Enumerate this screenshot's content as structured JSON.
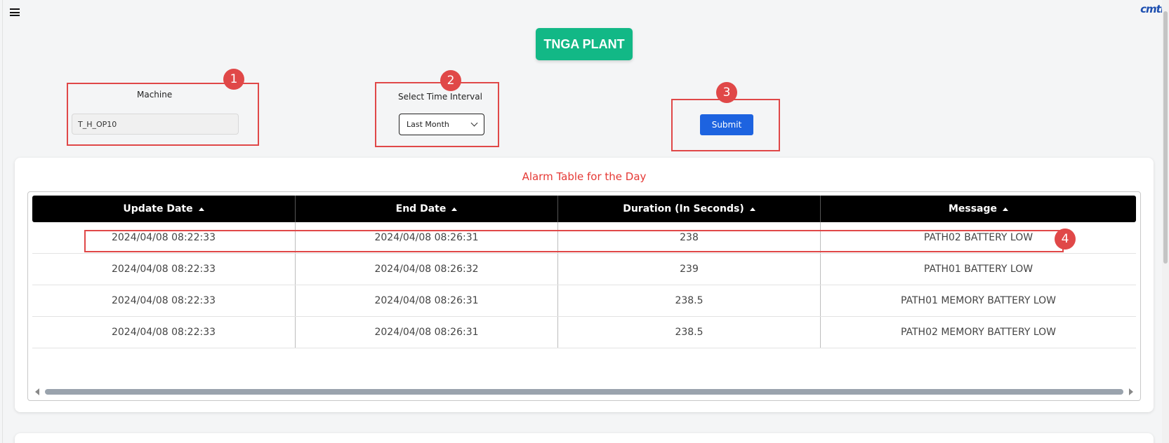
{
  "header": {
    "plant_name": "TNGA PLANT",
    "logo_text": "cmti"
  },
  "filters": {
    "machine_label": "Machine",
    "machine_value": "T_H_OP10",
    "interval_label": "Select Time Interval",
    "interval_selected": "Last Month",
    "submit_label": "Submit"
  },
  "annotations": [
    "1",
    "2",
    "3",
    "4"
  ],
  "alarm_table": {
    "title": "Alarm Table for the Day",
    "columns": [
      "Update Date",
      "End Date",
      "Duration (In Seconds)",
      "Message"
    ],
    "rows": [
      [
        "2024/04/08 08:22:33",
        "2024/04/08 08:26:31",
        "238",
        "PATH02 BATTERY LOW"
      ],
      [
        "2024/04/08 08:22:33",
        "2024/04/08 08:26:32",
        "239",
        "PATH01 BATTERY LOW"
      ],
      [
        "2024/04/08 08:22:33",
        "2024/04/08 08:26:31",
        "238.5",
        "PATH01 MEMORY BATTERY LOW"
      ],
      [
        "2024/04/08 08:22:33",
        "2024/04/08 08:26:31",
        "238.5",
        "PATH02 MEMORY BATTERY LOW"
      ]
    ]
  },
  "colors": {
    "plant_badge": "#12b886",
    "submit": "#1d63e0",
    "annotation": "#e04848",
    "table_title": "#e53935",
    "table_header": "#000000"
  },
  "icons": {
    "menu": "hamburger-menu-icon",
    "select_chevron": "chevron-down-icon"
  }
}
